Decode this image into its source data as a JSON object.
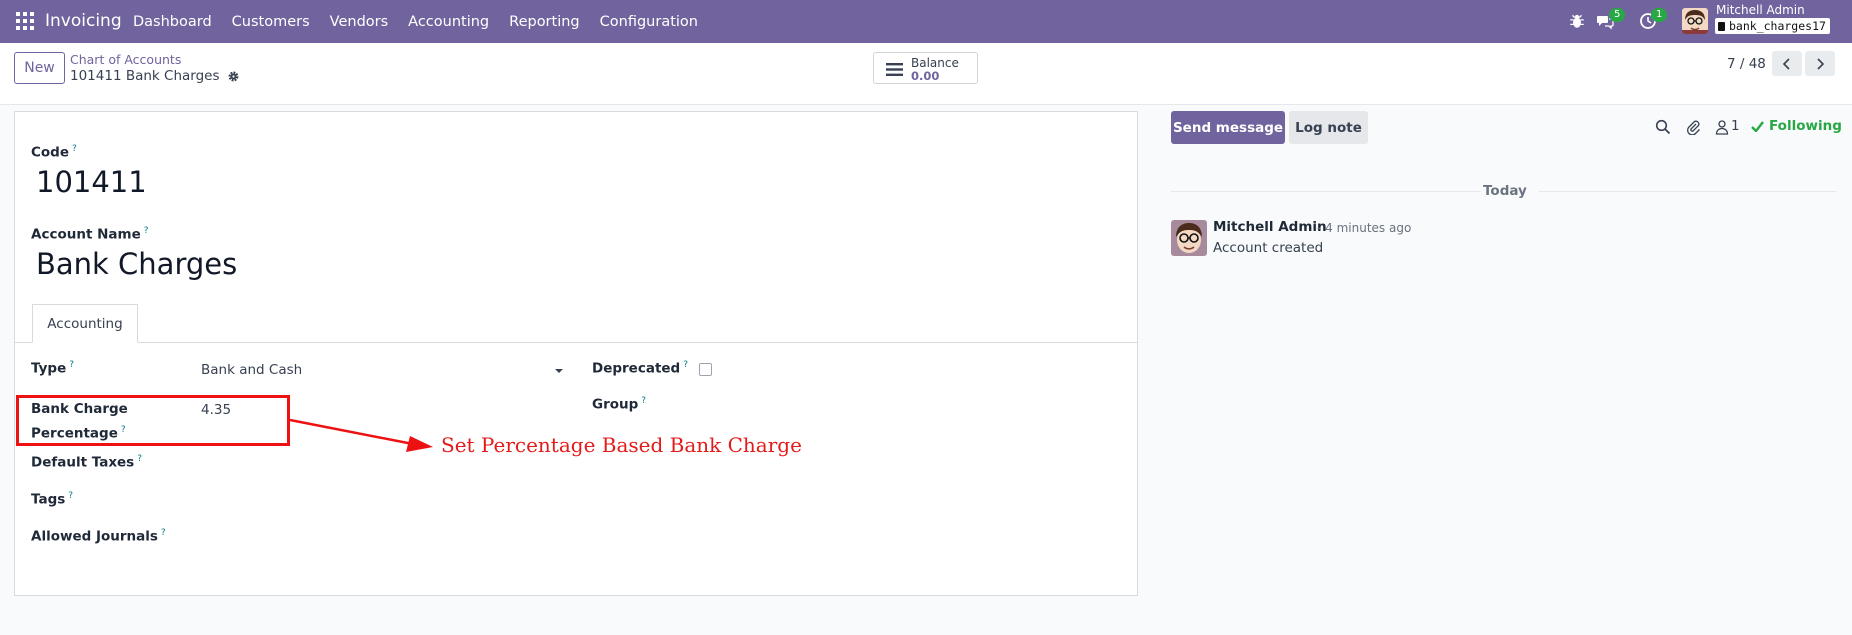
{
  "navbar": {
    "app_name": "Invoicing",
    "menu": [
      "Dashboard",
      "Customers",
      "Vendors",
      "Accounting",
      "Reporting",
      "Configuration"
    ],
    "messages_badge": "5",
    "activities_badge": "1",
    "user_name": "Mitchell Admin",
    "database": "bank_charges17"
  },
  "control_panel": {
    "new_label": "New",
    "breadcrumb_parent": "Chart of Accounts",
    "breadcrumb_current": "101411 Bank Charges",
    "balance_label": "Balance",
    "balance_value": "0.00",
    "pager": "7 / 48"
  },
  "form": {
    "code_label": "Code",
    "code_value": "101411",
    "name_label": "Account Name",
    "name_value": "Bank Charges",
    "tab_label": "Accounting",
    "type_label": "Type",
    "type_value": "Bank and Cash",
    "deprecated_label": "Deprecated",
    "group_label": "Group",
    "bank_charge_label_1": "Bank Charge",
    "bank_charge_label_2": "Percentage",
    "bank_charge_value": "4.35",
    "default_taxes_label": "Default Taxes",
    "tags_label": "Tags",
    "allowed_journals_label": "Allowed Journals",
    "help_mark": "?"
  },
  "annotation": {
    "text": "Set Percentage Based Bank Charge",
    "color": "#e31b1b"
  },
  "chatter": {
    "send_message": "Send message",
    "log_note": "Log note",
    "followers_count": "1",
    "following": "Following",
    "date_separator": "Today",
    "message": {
      "author": "Mitchell Admin",
      "time": "- 4 minutes ago",
      "body": "Account created"
    }
  },
  "colors": {
    "brand": "#71639e",
    "success": "#28a745",
    "annotation": "#ee1111"
  }
}
